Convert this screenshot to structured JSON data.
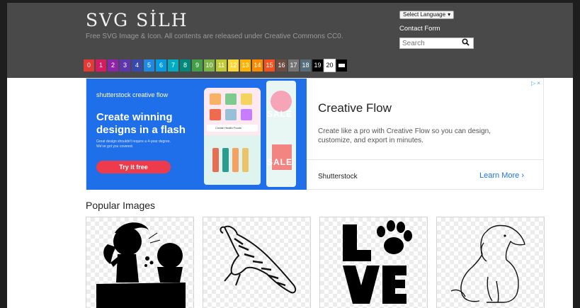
{
  "site": {
    "title": "SVG SİLH",
    "tagline": "Free SVG Image & Icon. All contents are released under Creative Commons CC0."
  },
  "header": {
    "language_select": "Select Language",
    "contact_link": "Contact Form",
    "search_placeholder": "Search"
  },
  "color_filters": [
    {
      "label": "0",
      "color": "#e53935"
    },
    {
      "label": "1",
      "color": "#d81b60"
    },
    {
      "label": "2",
      "color": "#8e24aa"
    },
    {
      "label": "3",
      "color": "#5e35b1"
    },
    {
      "label": "4",
      "color": "#3949ab"
    },
    {
      "label": "5",
      "color": "#1e88e5"
    },
    {
      "label": "6",
      "color": "#039be5"
    },
    {
      "label": "7",
      "color": "#00acc1"
    },
    {
      "label": "8",
      "color": "#00897b"
    },
    {
      "label": "9",
      "color": "#43a047"
    },
    {
      "label": "10",
      "color": "#7cb342"
    },
    {
      "label": "11",
      "color": "#c0ca33"
    },
    {
      "label": "12",
      "color": "#fdd835"
    },
    {
      "label": "13",
      "color": "#ffb300"
    },
    {
      "label": "14",
      "color": "#fb8c00"
    },
    {
      "label": "15",
      "color": "#f4511e"
    },
    {
      "label": "16",
      "color": "#6d4c41"
    },
    {
      "label": "17",
      "color": "#757575"
    },
    {
      "label": "18",
      "color": "#546e7a"
    },
    {
      "label": "19",
      "color": "#000000"
    },
    {
      "label": "20",
      "color": "#ffffff"
    },
    {
      "label": "",
      "color": "#000000"
    }
  ],
  "ad": {
    "brand": "shutterstock",
    "brand_suffix": "creative flow",
    "headline": "Create winning designs in a flash",
    "fine_print": "Great design shouldn't require a 4-year degree. We've got you covered.",
    "cta": "Try it free",
    "phone_caption": "Create Health Foods",
    "sale_text": "SALE",
    "title": "Creative Flow",
    "description": "Create like a pro with Creative Flow so you can design, customize, and export in minutes.",
    "advertiser": "Shutterstock",
    "learn_more": "Learn More",
    "learn_more_arrow": "›",
    "adchoices": "▷ ×"
  },
  "popular": {
    "title": "Popular Images",
    "images": [
      {
        "icon": "girl-silhouette-icon"
      },
      {
        "icon": "tiger-icon"
      },
      {
        "icon": "love-paw-icon"
      },
      {
        "icon": "dog-outline-icon"
      }
    ]
  },
  "colors": {
    "header_bg": "#494949",
    "page_bg": "#ffffff",
    "ad_blue": "#1f6eea",
    "cta_red": "#ee3b4c",
    "link_blue": "#1a73e8"
  }
}
